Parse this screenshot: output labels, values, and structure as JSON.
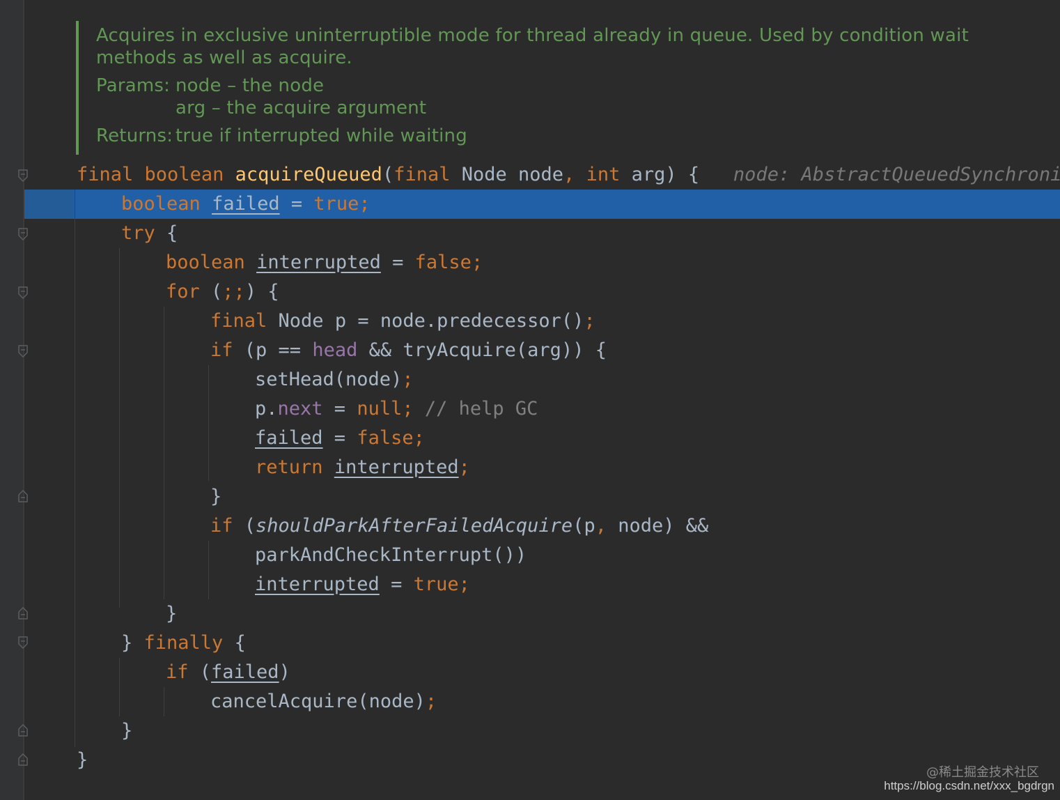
{
  "doc": {
    "line1": "Acquires in exclusive uninterruptible mode for thread already in queue. Used by condition wait",
    "line2": "methods as well as acquire.",
    "params_label": "Params:",
    "param1": "node – the node",
    "param2": "arg – the acquire argument",
    "returns_label": "Returns:",
    "returns": "true if interrupted while waiting"
  },
  "code": {
    "l1": {
      "final": "final",
      "boolean": "boolean",
      "name": "acquireQueued",
      "open": "(",
      "final2": "final",
      "rest1": " Node node",
      "comma": ",",
      "int": " int",
      "rest2": " arg) {",
      "hint": "node: AbstractQueuedSynchronize"
    },
    "l2": {
      "boolean": "boolean",
      "var": "failed",
      "eq": " = ",
      "val": "true",
      "semi": ";"
    },
    "l3": {
      "try": "try",
      "rest": " {"
    },
    "l4": {
      "boolean": "boolean",
      "var": "interrupted",
      "eq": " = ",
      "val": "false",
      "semi": ";"
    },
    "l5": {
      "for": "for",
      "p1": " (",
      "semis": ";;",
      "p2": ") {"
    },
    "l6": {
      "final": "final",
      "rest": " Node p = node.predecessor()",
      "semi": ";"
    },
    "l7": {
      "if": "if",
      "p1": " (p == ",
      "head": "head",
      "p2": " && tryAcquire(arg)) {"
    },
    "l8": {
      "text": "setHead(node)",
      "semi": ";"
    },
    "l9": {
      "p": "p.",
      "next": "next",
      "eq": " = ",
      "null": "null",
      "semi": ";",
      "comment": " // help GC"
    },
    "l10": {
      "var": "failed",
      "eq": " = ",
      "val": "false",
      "semi": ";"
    },
    "l11": {
      "ret": "return",
      "var": "interrupted",
      "semi": ";"
    },
    "l12": {
      "text": "}"
    },
    "l13": {
      "if": "if",
      "p1": " (",
      "fn": "shouldParkAfterFailedAcquire",
      "p2": "(p",
      "comma": ",",
      "p3": " node) &&"
    },
    "l14": {
      "text": "parkAndCheckInterrupt())"
    },
    "l15": {
      "var": "interrupted",
      "eq": " = ",
      "val": "true",
      "semi": ";"
    },
    "l16": {
      "text": "}"
    },
    "l17": {
      "close": "} ",
      "finally": "finally",
      "rest": " {"
    },
    "l18": {
      "if": "if",
      "p1": " (",
      "var": "failed",
      "p2": ")"
    },
    "l19": {
      "text": "cancelAcquire(node)",
      "semi": ";"
    },
    "l20": {
      "text": "}"
    },
    "l21": {
      "text": "}"
    }
  },
  "watermark": {
    "line1": "@稀土掘金技术社区",
    "line2": "https://blog.csdn.net/xxx_bgdrgn"
  },
  "colors": {
    "background": "#2b2b2b",
    "keyword": "#cc7832",
    "function": "#ffc66d",
    "field": "#9876aa",
    "doc": "#629755",
    "selection": "#2160a6"
  }
}
